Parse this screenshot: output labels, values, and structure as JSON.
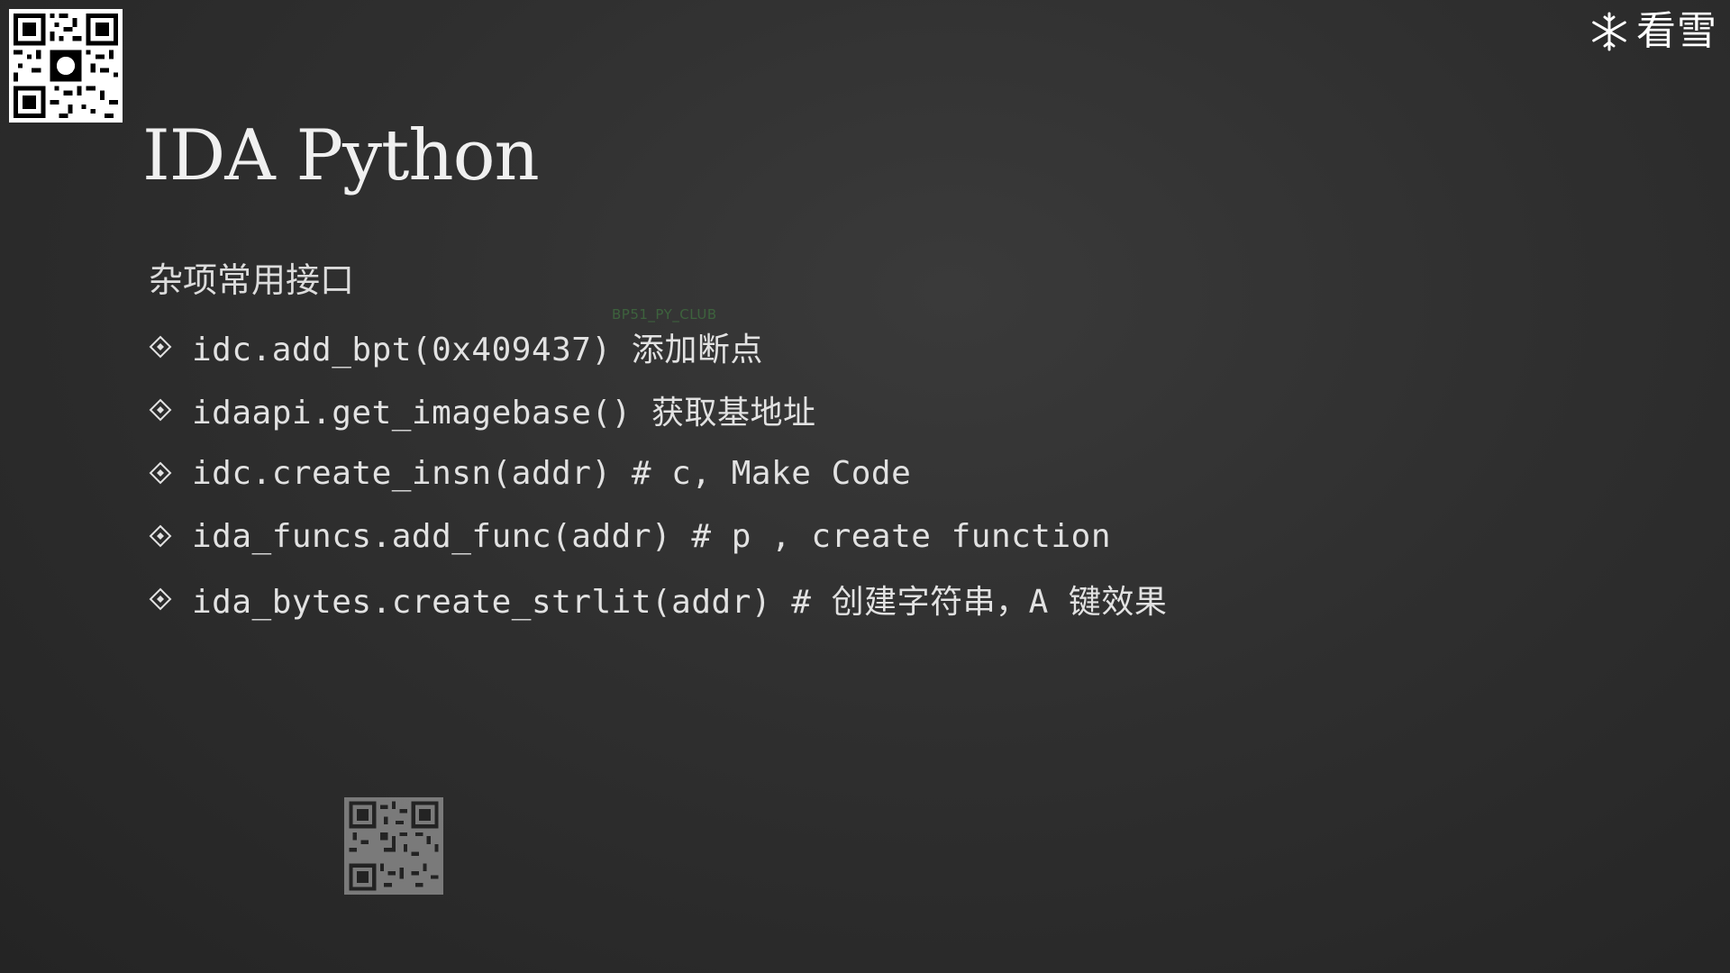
{
  "slide": {
    "title": "IDA Python",
    "subtitle": "杂项常用接口",
    "watermark": "BP51_PY_CLUB",
    "brand_text": "看雪",
    "bullets": [
      {
        "text": "idc.add_bpt(0x409437) 添加断点"
      },
      {
        "text": "idaapi.get_imagebase() 获取基地址"
      },
      {
        "text": "idc.create_insn(addr) # c, Make Code"
      },
      {
        "text": "ida_funcs.add_func(addr) # p , create function"
      },
      {
        "text": "ida_bytes.create_strlit(addr) # 创建字符串，A 键效果"
      }
    ]
  },
  "icons": {
    "top_qr": "qr-code-icon",
    "bottom_qr": "qr-code-icon",
    "brand_logo": "snowflake-icon",
    "bullet_marker": "diamond-bullet-icon"
  },
  "colors": {
    "background": "#2f2f2f",
    "text": "#e6e6e6",
    "watermark": "#3f6b3f"
  }
}
